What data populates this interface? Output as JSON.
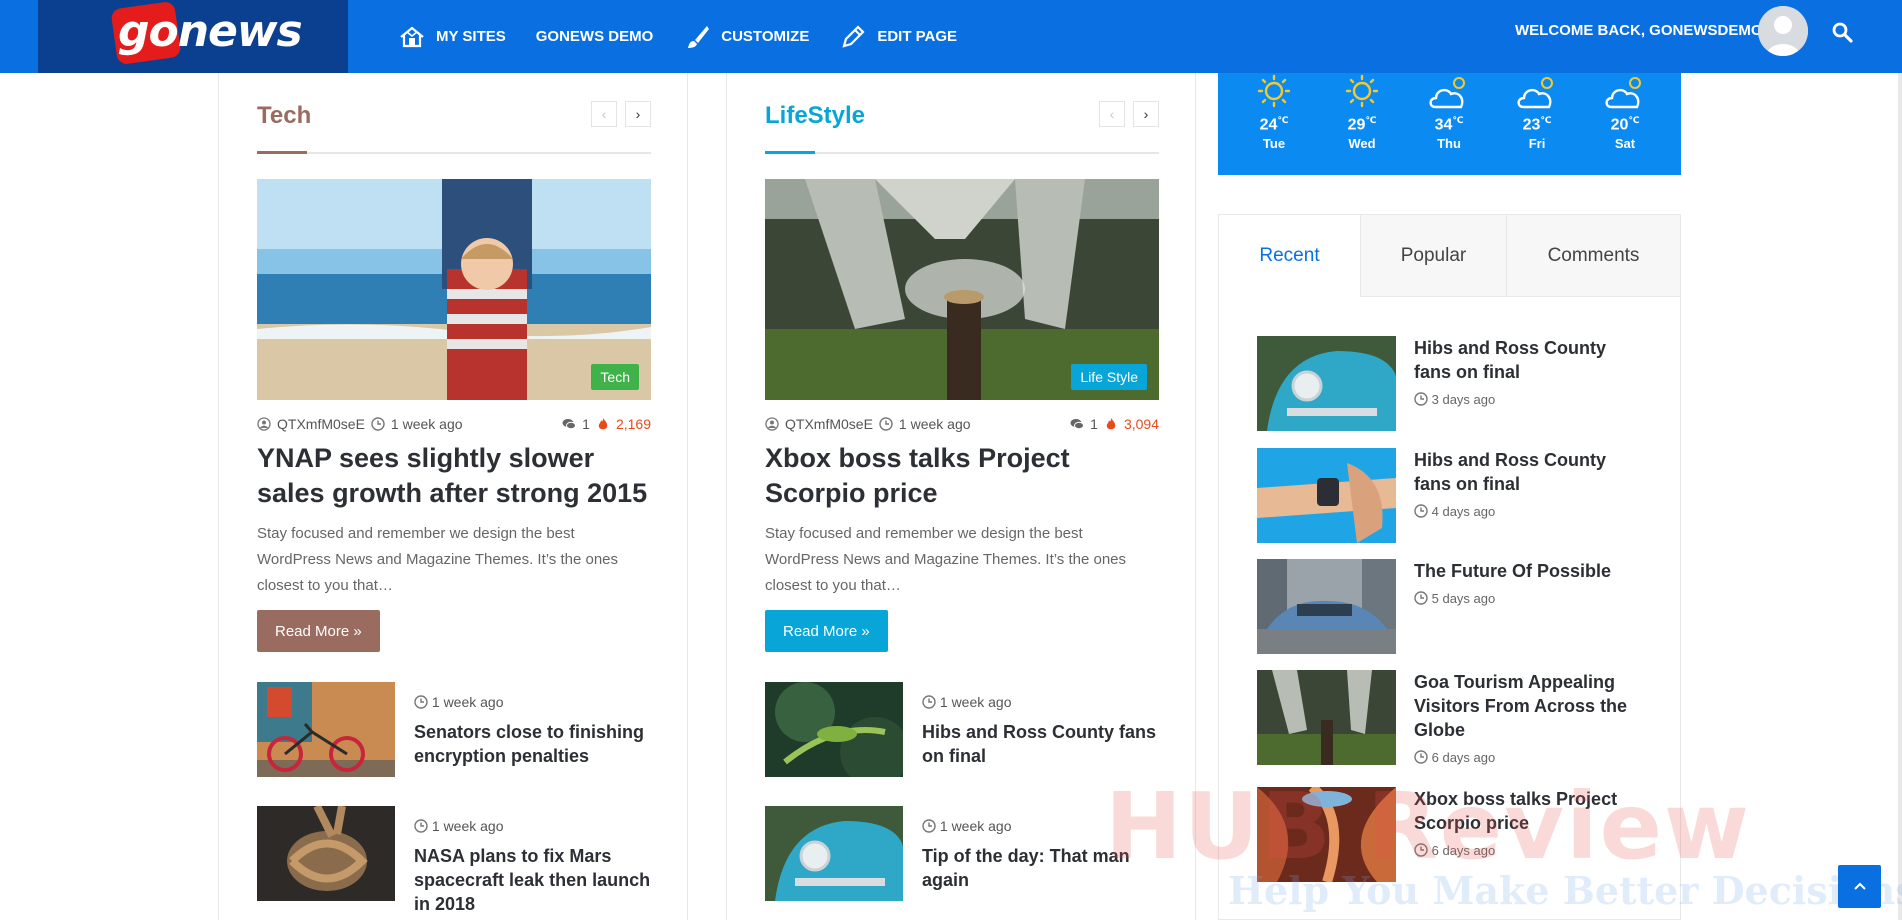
{
  "header": {
    "logo": "gonews",
    "nav": [
      {
        "label": "My Sites",
        "icon": "my-sites-icon"
      },
      {
        "label": "goNews Demo",
        "icon": ""
      },
      {
        "label": "Customize",
        "icon": "brush-icon"
      },
      {
        "label": "Edit Page",
        "icon": "pencil-icon"
      }
    ],
    "welcome": "Welcome back, gonewsdemo"
  },
  "colors": {
    "brand_blue": "#0a6fe0",
    "tech_accent": "#9a6b5f",
    "lifestyle_accent": "#08a6d8",
    "weather_bg": "#0b8bf2",
    "hot_red": "#e84a1a"
  },
  "tech": {
    "title": "Tech",
    "badge": "Tech",
    "author": "QTXmfM0seE",
    "time": "1 week ago",
    "comments": "1",
    "views": "2,169",
    "headline": "YNAP sees slightly slower sales growth after strong 2015",
    "excerpt": "Stay focused and remember we design the best WordPress News and Magazine Themes. It’s the ones closest to you that…",
    "read_more": "Read More »",
    "items": [
      {
        "time": "1 week ago",
        "title": "Senators close to finishing encryption penalties"
      },
      {
        "time": "1 week ago",
        "title": "NASA plans to fix Mars spacecraft leak then launch in 2018"
      }
    ]
  },
  "lifestyle": {
    "title": "LifeStyle",
    "badge": "Life Style",
    "author": "QTXmfM0seE",
    "time": "1 week ago",
    "comments": "1",
    "views": "3,094",
    "headline": "Xbox boss talks Project Scorpio price",
    "excerpt": "Stay focused and remember we design the best WordPress News and Magazine Themes. It’s the ones closest to you that…",
    "read_more": "Read More »",
    "items": [
      {
        "time": "1 week ago",
        "title": "Hibs and Ross County fans on final"
      },
      {
        "time": "1 week ago",
        "title": "Tip of the day: That man again"
      }
    ]
  },
  "weather": [
    {
      "temp": "24",
      "unit": "℃",
      "day": "Tue",
      "icon": "sun-icon"
    },
    {
      "temp": "29",
      "unit": "℃",
      "day": "Wed",
      "icon": "sun-icon"
    },
    {
      "temp": "34",
      "unit": "℃",
      "day": "Thu",
      "icon": "cloud-sun-icon"
    },
    {
      "temp": "23",
      "unit": "℃",
      "day": "Fri",
      "icon": "cloud-sun-icon"
    },
    {
      "temp": "20",
      "unit": "℃",
      "day": "Sat",
      "icon": "cloud-sun-icon"
    }
  ],
  "tabs": {
    "labels": [
      "Recent",
      "Popular",
      "Comments"
    ],
    "recent": [
      {
        "title": "Hibs and Ross County fans on final",
        "time": "3 days ago"
      },
      {
        "title": "Hibs and Ross County fans on final",
        "time": "4 days ago"
      },
      {
        "title": "The Future Of Possible",
        "time": "5 days ago"
      },
      {
        "title": "Goa Tourism Appealing Visitors From Across the Globe",
        "time": "6 days ago"
      },
      {
        "title": "Xbox boss talks Project Scorpio price",
        "time": "6 days ago"
      }
    ]
  },
  "watermark": {
    "line1": "HUB Review",
    "line2": "Help You Make Better Decisions"
  }
}
